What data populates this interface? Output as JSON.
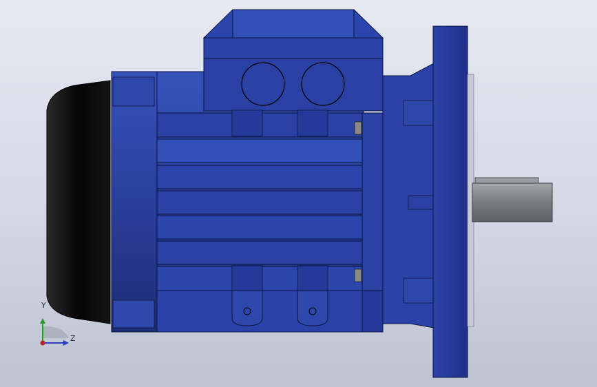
{
  "viewport": {
    "background_top": "#e6e9f1",
    "background_bottom": "#bec3d2"
  },
  "model": {
    "description_icon": "electric-motor-flange-mount",
    "body_color": "#2a3f9c",
    "body_dark_color": "#1e2f7a",
    "fan_cover_color": "#0d0d0d",
    "shaft_color": "#7d7f86"
  },
  "triad": {
    "y_label": "Y",
    "z_label": "Z",
    "y_color": "#2a9a2a",
    "z_color": "#2a3fc0",
    "x_color": "#c02020"
  }
}
